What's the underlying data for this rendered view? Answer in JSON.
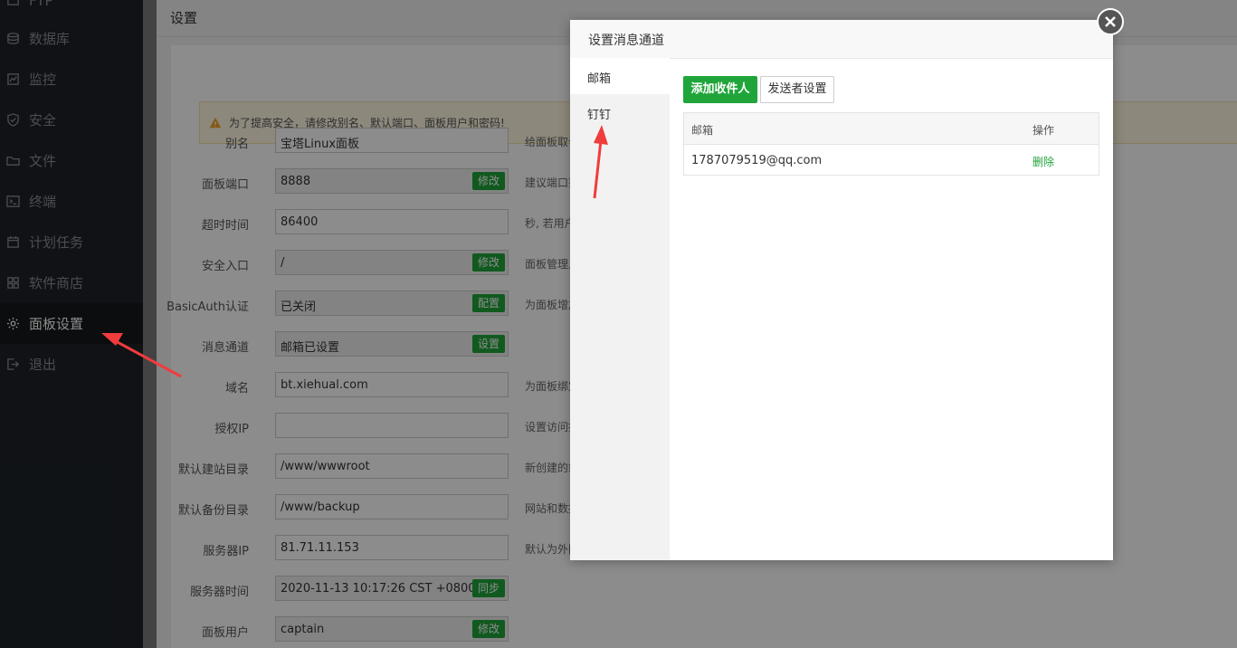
{
  "sidebar": {
    "items": [
      {
        "label": "FTP",
        "icon": "ftp-icon"
      },
      {
        "label": "数据库",
        "icon": "database-icon"
      },
      {
        "label": "监控",
        "icon": "monitor-icon"
      },
      {
        "label": "安全",
        "icon": "shield-icon"
      },
      {
        "label": "文件",
        "icon": "folder-icon"
      },
      {
        "label": "终端",
        "icon": "terminal-icon"
      },
      {
        "label": "计划任务",
        "icon": "calendar-icon"
      },
      {
        "label": "软件商店",
        "icon": "grid-icon"
      },
      {
        "label": "面板设置",
        "icon": "gear-icon",
        "active": true
      },
      {
        "label": "退出",
        "icon": "logout-icon"
      }
    ]
  },
  "main": {
    "title": "设置",
    "alert": "为了提高安全，请修改别名、默认端口、面板用户和密码!",
    "rows": [
      {
        "label": "别名",
        "value": "宝塔Linux面板",
        "hint": "给面板取个别"
      },
      {
        "label": "面板端口",
        "value": "8888",
        "button": "修改",
        "hint": "建议端口范围"
      },
      {
        "label": "超时时间",
        "value": "86400",
        "hint": "秒, 若用户在"
      },
      {
        "label": "安全入口",
        "value": "/",
        "button": "修改",
        "hint": "面板管理入口"
      },
      {
        "label": "BasicAuth认证",
        "value": "已关闭",
        "button": "配置",
        "hint": "为面板增加一"
      },
      {
        "label": "消息通道",
        "value": "邮箱已设置",
        "button": "设置",
        "hint": ""
      },
      {
        "label": "域名",
        "value": "bt.xiehual.com",
        "hint": "为面板绑定一"
      },
      {
        "label": "授权IP",
        "value": "",
        "hint": "设置访问授权"
      },
      {
        "label": "默认建站目录",
        "value": "/www/wwwroot",
        "hint": "新创建的站点"
      },
      {
        "label": "默认备份目录",
        "value": "/www/backup",
        "hint": "网站和数据库"
      },
      {
        "label": "服务器IP",
        "value": "81.71.11.153",
        "hint": "默认为外网IP"
      },
      {
        "label": "服务器时间",
        "value": "2020-11-13 10:17:26 CST +0800",
        "button": "同步",
        "hint": ""
      },
      {
        "label": "面板用户",
        "value": "captain",
        "button": "修改",
        "hint": ""
      }
    ]
  },
  "modal": {
    "title": "设置消息通道",
    "nav": [
      {
        "label": "邮箱",
        "active": true
      },
      {
        "label": "钉钉",
        "active": false
      }
    ],
    "add_button": "添加收件人",
    "sender_button": "发送者设置",
    "table": {
      "headers": [
        "邮箱",
        "操作"
      ],
      "rows": [
        {
          "email": "1787079519@qq.com",
          "action": "删除"
        }
      ]
    }
  },
  "colors": {
    "accent": "#20a53a",
    "sidebar_bg": "#1e2228",
    "arrow": "#f03c3c"
  }
}
